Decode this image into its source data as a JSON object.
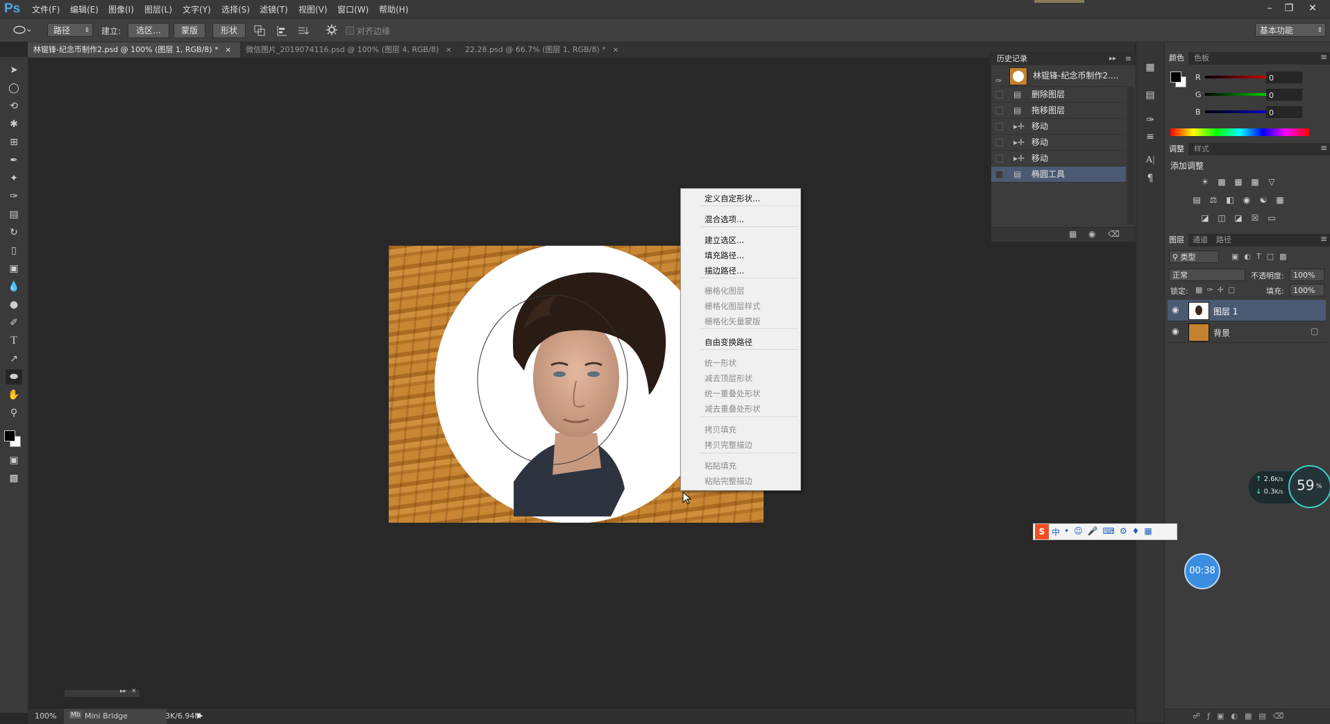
{
  "app": {
    "logo": "Ps"
  },
  "menu": [
    "文件(F)",
    "编辑(E)",
    "图像(I)",
    "图层(L)",
    "文字(Y)",
    "选择(S)",
    "滤镜(T)",
    "视图(V)",
    "窗口(W)",
    "帮助(H)"
  ],
  "options": {
    "mode": "路径",
    "create_label": "建立:",
    "selection_button": "选区...",
    "mask_button": "蒙版",
    "shape_button": "形状",
    "align_edges": "对齐边缘",
    "workspace": "基本功能"
  },
  "tabs": [
    {
      "label": "林锟锋-纪念币制作2.psd @ 100% (图层 1, RGB/8) *"
    },
    {
      "label": "微信图片_2019074116.psd @ 100% (图层 4, RGB/8)"
    },
    {
      "label": "22.28.psd @ 66.7% (图层 1, RGB/8) *"
    }
  ],
  "context_menu": [
    {
      "label": "定义自定形状...",
      "enabled": true
    },
    {
      "label": "混合选项...",
      "enabled": true
    },
    {
      "label": "建立选区...",
      "enabled": true
    },
    {
      "label": "填充路径...",
      "enabled": true
    },
    {
      "label": "描边路径...",
      "enabled": true
    },
    {
      "label": "栅格化图层",
      "enabled": false
    },
    {
      "label": "栅格化图层样式",
      "enabled": false
    },
    {
      "label": "栅格化矢量蒙版",
      "enabled": false
    },
    {
      "label": "自由变换路径",
      "enabled": true
    },
    {
      "label": "统一形状",
      "enabled": false
    },
    {
      "label": "减去顶层形状",
      "enabled": false
    },
    {
      "label": "统一重叠处形状",
      "enabled": false
    },
    {
      "label": "减去重叠处形状",
      "enabled": false
    },
    {
      "label": "拷贝填充",
      "enabled": false
    },
    {
      "label": "拷贝完整描边",
      "enabled": false
    },
    {
      "label": "粘贴填充",
      "enabled": false
    },
    {
      "label": "粘贴完整描边",
      "enabled": false
    }
  ],
  "history": {
    "title": "历史记录",
    "snapshot": "林锟锋-纪念币制作2....",
    "items": [
      {
        "label": "删除图层"
      },
      {
        "label": "拖移图层"
      },
      {
        "label": "移动"
      },
      {
        "label": "移动"
      },
      {
        "label": "移动"
      },
      {
        "label": "椭圆工具"
      }
    ]
  },
  "color_panel": {
    "tabs": [
      "颜色",
      "色板"
    ],
    "r_label": "R",
    "g_label": "G",
    "b_label": "B",
    "r": "0",
    "g": "0",
    "b": "0"
  },
  "adjust_panel": {
    "tabs": [
      "调整",
      "样式"
    ],
    "title": "添加调整"
  },
  "layers_panel": {
    "tabs": [
      "图层",
      "通道",
      "路径"
    ],
    "filter": "类型",
    "blend_mode": "正常",
    "opacity_label": "不透明度:",
    "opacity": "100%",
    "lock_label": "锁定:",
    "fill_label": "填充:",
    "fill": "100%",
    "layers": [
      {
        "name": "图层 1"
      },
      {
        "name": "背景"
      }
    ]
  },
  "status": {
    "zoom": "100%",
    "bridge": "Mini Bridge",
    "doc_size": "3K/6.94M"
  },
  "overlays": {
    "net_up": "2.6",
    "net_down": "0.3",
    "net_unit": "K/s",
    "cpu": "59",
    "cpu_unit": "%",
    "timer": "00:38",
    "ime_lang": "中"
  }
}
